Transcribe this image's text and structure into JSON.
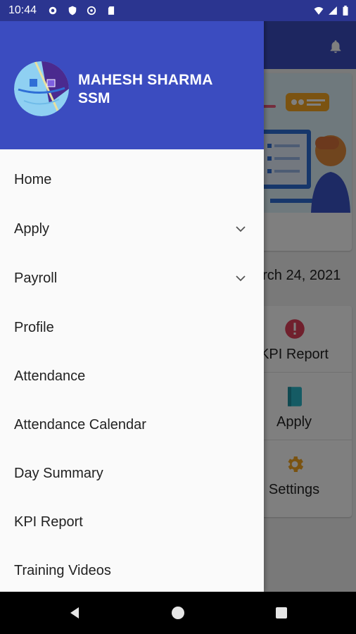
{
  "status_bar": {
    "time": "10:44",
    "icons": [
      "gear-icon",
      "shield-icon",
      "at-sign-icon",
      "sd-card-icon",
      "wifi-icon",
      "signal-icon",
      "battery-icon"
    ]
  },
  "background": {
    "date": "arch 24, 2021",
    "tiles": [
      {
        "label": "KPI Report",
        "icon": "alert-icon"
      },
      {
        "label": "Apply",
        "icon": "book-icon"
      },
      {
        "label": "Settings",
        "icon": "gear-icon"
      }
    ]
  },
  "drawer": {
    "user": {
      "name": "MAHESH SHARMA",
      "role": "SSM"
    },
    "items": [
      {
        "label": "Home",
        "expandable": false
      },
      {
        "label": "Apply",
        "expandable": true
      },
      {
        "label": "Payroll",
        "expandable": true
      },
      {
        "label": "Profile",
        "expandable": false
      },
      {
        "label": "Attendance",
        "expandable": false
      },
      {
        "label": "Attendance Calendar",
        "expandable": false
      },
      {
        "label": "Day Summary",
        "expandable": false
      },
      {
        "label": "KPI Report",
        "expandable": false
      },
      {
        "label": "Training Videos",
        "expandable": false
      }
    ]
  },
  "colors": {
    "primary": "#3b4cc0",
    "status_bar": "#2b3590",
    "drawer_bg": "#fafafa"
  }
}
